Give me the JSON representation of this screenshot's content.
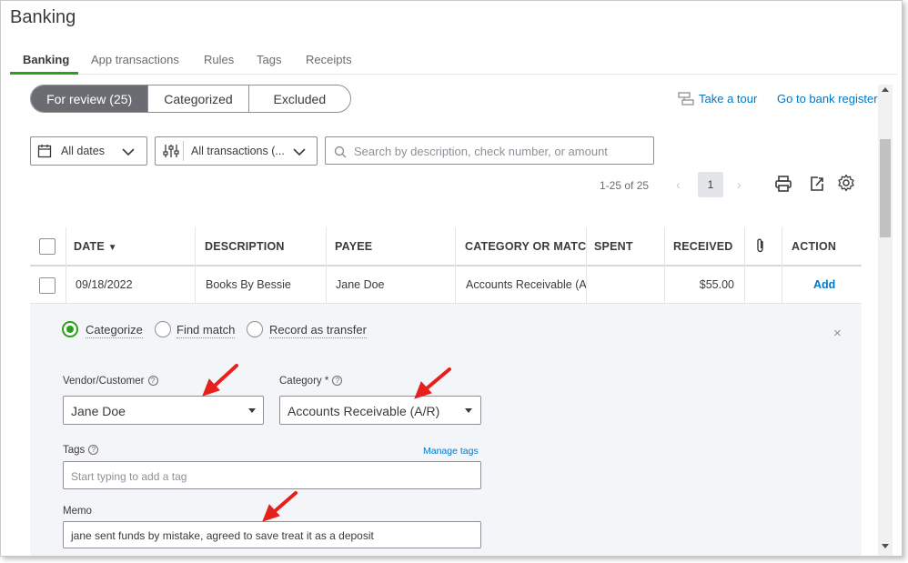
{
  "page": {
    "title": "Banking"
  },
  "tabs": [
    {
      "label": "Banking",
      "active": true
    },
    {
      "label": "App transactions"
    },
    {
      "label": "Rules"
    },
    {
      "label": "Tags"
    },
    {
      "label": "Receipts"
    }
  ],
  "segments": {
    "for_review": "For review (25)",
    "categorized": "Categorized",
    "excluded": "Excluded"
  },
  "links": {
    "take_tour": "Take a tour",
    "bank_register": "Go to bank register"
  },
  "filters": {
    "dates": "All dates",
    "transactions": "All transactions (...",
    "search_placeholder": "Search by description, check number, or amount"
  },
  "pager": {
    "range": "1-25 of 25",
    "page": "1"
  },
  "table": {
    "headers": {
      "date": "DATE",
      "description": "DESCRIPTION",
      "payee": "PAYEE",
      "category": "CATEGORY OR MATCH",
      "spent": "SPENT",
      "received": "RECEIVED",
      "action": "ACTION"
    },
    "rows": [
      {
        "date": "09/18/2022",
        "description": "Books By Bessie",
        "payee": "Jane Doe",
        "category": "Accounts Receivable (A",
        "spent": "",
        "received": "$55.00",
        "action": "Add"
      }
    ]
  },
  "detail": {
    "radios": {
      "categorize": "Categorize",
      "find_match": "Find match",
      "record_transfer": "Record as transfer"
    },
    "vendor_label": "Vendor/Customer",
    "vendor_value": "Jane Doe",
    "category_label": "Category *",
    "category_value": "Accounts Receivable (A/R)",
    "tags_label": "Tags",
    "manage_tags": "Manage tags",
    "tags_placeholder": "Start typing to add a tag",
    "memo_label": "Memo",
    "memo_value": "jane sent funds by mistake, agreed to save treat it as a deposit"
  },
  "colors": {
    "accent_green": "#2ca01c",
    "link_blue": "#0077c5",
    "annotation_red": "#e8201b"
  },
  "icons": [
    "calendar-icon",
    "filter-sliders-icon",
    "search-icon",
    "tour-icon",
    "print-icon",
    "export-icon",
    "gear-icon",
    "attachment-icon",
    "close-icon",
    "help-icon",
    "caret-down-icon",
    "sort-down-icon"
  ]
}
